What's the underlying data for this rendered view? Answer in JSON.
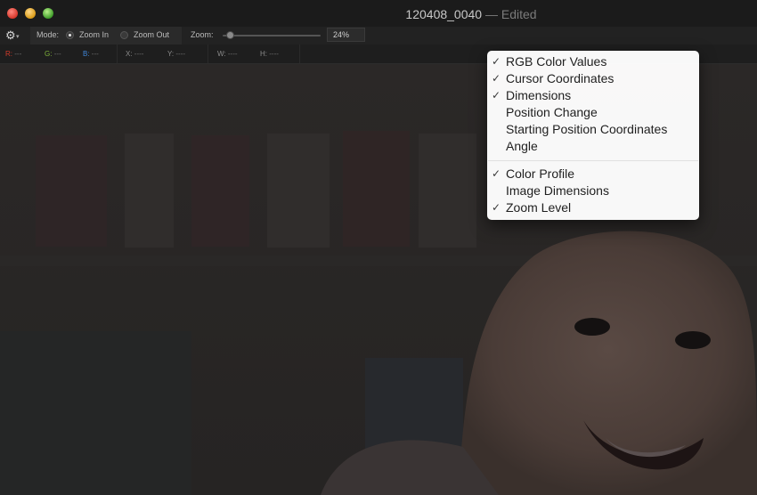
{
  "window": {
    "title": "120408_0040",
    "edited_suffix": "— Edited"
  },
  "toolbar": {
    "mode_label": "Mode:",
    "zoom_in_label": "Zoom In",
    "zoom_out_label": "Zoom Out",
    "zoom_label": "Zoom:",
    "zoom_value": "24%",
    "selected_mode": "zoom_in",
    "zoom_slider_fraction": 0.08
  },
  "infobar": {
    "r_label": "R:",
    "r_value": "---",
    "g_label": "G:",
    "g_value": "---",
    "b_label": "B:",
    "b_value": "---",
    "x_label": "X:",
    "x_value": "----",
    "y_label": "Y:",
    "y_value": "----",
    "w_label": "W:",
    "w_value": "----",
    "h_label": "H:",
    "h_value": "----"
  },
  "menu": {
    "items": [
      {
        "label": "RGB Color Values",
        "checked": true
      },
      {
        "label": "Cursor Coordinates",
        "checked": true
      },
      {
        "label": "Dimensions",
        "checked": true
      },
      {
        "label": "Position Change",
        "checked": false
      },
      {
        "label": "Starting Position Coordinates",
        "checked": false
      },
      {
        "label": "Angle",
        "checked": false
      },
      {
        "label": "Color Profile",
        "checked": true
      },
      {
        "label": "Image Dimensions",
        "checked": false
      },
      {
        "label": "Zoom Level",
        "checked": true
      }
    ],
    "check_glyph": "✓"
  },
  "colors": {
    "r": "#d23a2a",
    "g": "#7fb23a",
    "b": "#3f86d8"
  }
}
